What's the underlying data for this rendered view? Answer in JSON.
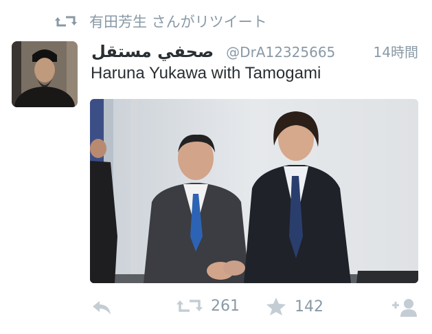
{
  "retweeter": {
    "icon": "retweet-icon",
    "text": "有田芳生 さんがリツイート"
  },
  "tweet": {
    "display_name": "صحفي مستقل",
    "handle": "@DrA12325665",
    "timestamp": "14時間",
    "text": "Haruna Yukawa with Tamogami",
    "avatar": "avatar-photo"
  },
  "actions": {
    "reply": {
      "icon": "reply-icon"
    },
    "retweet": {
      "icon": "retweet-icon",
      "count": "261"
    },
    "favorite": {
      "icon": "star-icon",
      "count": "142"
    },
    "follow": {
      "icon": "add-user-icon"
    }
  },
  "colors": {
    "text": "#292f33",
    "secondary": "#8899a6"
  }
}
